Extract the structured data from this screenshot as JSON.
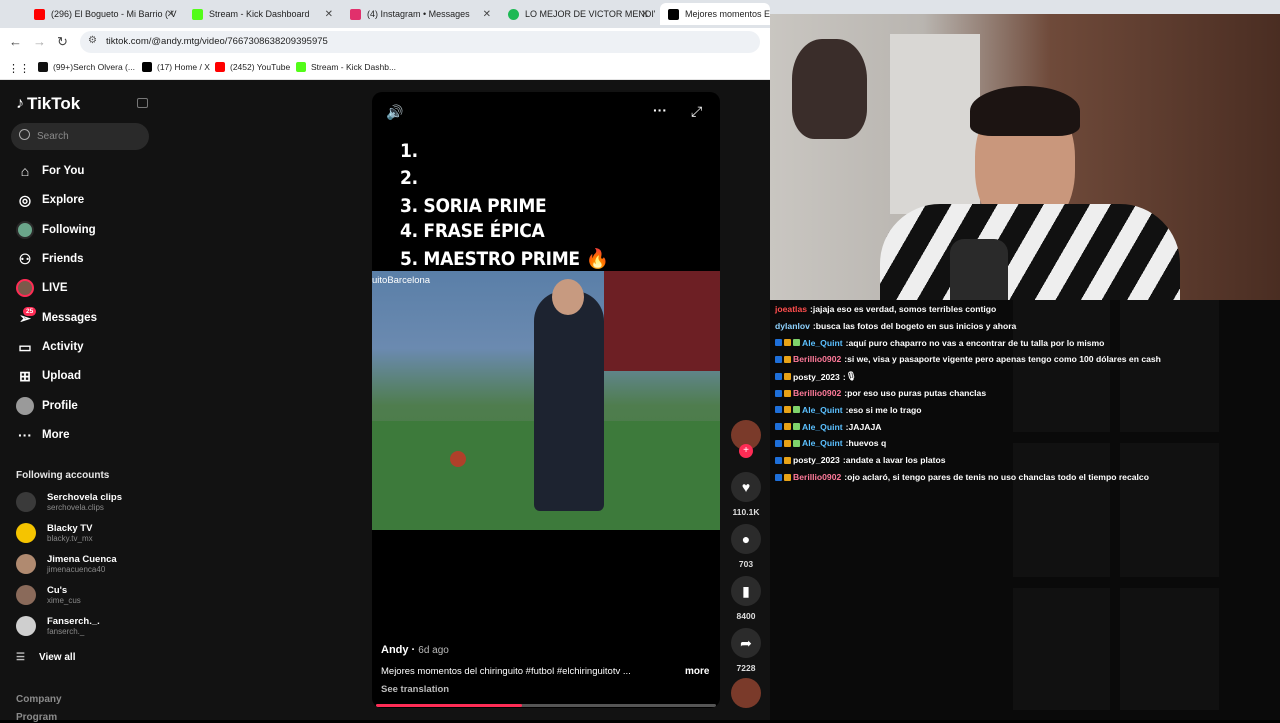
{
  "browser": {
    "tabs": [
      {
        "label": "(296) El Bogueto - Mi Barrio ( V",
        "fav": "#ff0000"
      },
      {
        "label": "Stream - Kick Dashboard",
        "fav": "#53fc18"
      },
      {
        "label": "(4) Instagram • Messages",
        "fav": "#e1306c"
      },
      {
        "label": "LO MEJOR DE VICTOR MENDIV",
        "fav": "#1db954"
      },
      {
        "label": "Mejores momentos El Ch",
        "fav": "#000000"
      }
    ],
    "url": "tiktok.com/@andy.mtg/video/7667308638209395975",
    "bookmarks": [
      {
        "label": "(99+)Serch Olvera (...",
        "fav": "#111111"
      },
      {
        "label": "(17) Home / X",
        "fav": "#000000"
      },
      {
        "label": "(2452) YouTube",
        "fav": "#ff0000"
      },
      {
        "label": "Stream - Kick Dashb...",
        "fav": "#53fc18"
      }
    ]
  },
  "tiktok": {
    "logo": "TikTok",
    "search_placeholder": "Search",
    "nav": [
      {
        "label": "For You",
        "icon": "home-icon"
      },
      {
        "label": "Explore",
        "icon": "compass-icon"
      },
      {
        "label": "Following",
        "icon": "following-avatar"
      },
      {
        "label": "Friends",
        "icon": "friends-icon"
      },
      {
        "label": "LIVE",
        "icon": "live-icon"
      },
      {
        "label": "Messages",
        "icon": "messages-icon"
      },
      {
        "label": "Activity",
        "icon": "activity-icon"
      },
      {
        "label": "Upload",
        "icon": "upload-icon"
      },
      {
        "label": "Profile",
        "icon": "profile-avatar"
      },
      {
        "label": "More",
        "icon": "more-icon"
      }
    ],
    "messages_badge": "25",
    "following_title": "Following accounts",
    "accounts": [
      {
        "name": "Serchovela clips",
        "handle": "serchovela.clips",
        "color": "#3a3a3a"
      },
      {
        "name": "Blacky TV",
        "handle": "blacky.tv_mx",
        "color": "#f5c400"
      },
      {
        "name": "Jimena Cuenca",
        "handle": "jimenacuenca40",
        "color": "#b08a70"
      },
      {
        "name": "Cu's",
        "handle": "xime_cus",
        "color": "#8a6a5a"
      },
      {
        "name": "Fanserch._.",
        "handle": "fanserch._",
        "color": "#cfcfcf"
      }
    ],
    "view_all": "View all",
    "footer": [
      "Company",
      "Program"
    ],
    "video": {
      "list": [
        "1.",
        "2.",
        "3. SORIA PRIME",
        "4. FRASE ÉPICA",
        "5. MAESTRO PRIME 🔥"
      ],
      "clip_tag": "uitoBarcelona",
      "author": "Andy",
      "ago": "6d ago",
      "caption": "Mejores momentos del chiringuito #futbol #elchiringuitotv ...",
      "more": "more",
      "see_translation": "See translation",
      "progress": 0.43
    },
    "actions": [
      {
        "icon": "heart-icon",
        "count": "110.1K"
      },
      {
        "icon": "comment-icon",
        "count": "703"
      },
      {
        "icon": "bookmark-icon",
        "count": "8400"
      },
      {
        "icon": "share-icon",
        "count": "7228"
      }
    ]
  },
  "stream": {
    "chat": [
      {
        "user": "joeatlas",
        "color": "#ff4d4d",
        "text": "jajaja eso es verdad, somos terribles contigo",
        "badges": 0
      },
      {
        "user": "dylanlov",
        "color": "#8fd3ff",
        "text": "busca las fotos del bogeto en sus inicios y ahora",
        "badges": 0
      },
      {
        "user": "Ale_Quint",
        "color": "#5bc0ff",
        "text": "aquí puro chaparro no vas a encontrar de tu talla por lo mismo",
        "badges": 3
      },
      {
        "user": "Berillio0902",
        "color": "#ff7a9a",
        "text": "si we, visa y pasaporte vigente pero apenas tengo como 100 dólares en cash",
        "badges": 2
      },
      {
        "user": "posty_2023",
        "color": "#ffffff",
        "text": "🎙",
        "badges": 2
      },
      {
        "user": "Berillio0902",
        "color": "#ff7a9a",
        "text": "por eso uso puras putas chanclas",
        "badges": 2
      },
      {
        "user": "Ale_Quint",
        "color": "#5bc0ff",
        "text": "eso si me lo trago",
        "badges": 3
      },
      {
        "user": "Ale_Quint",
        "color": "#5bc0ff",
        "text": "JAJAJA",
        "badges": 3
      },
      {
        "user": "Ale_Quint",
        "color": "#5bc0ff",
        "text": "huevos q",
        "badges": 3
      },
      {
        "user": "posty_2023",
        "color": "#ffffff",
        "text": "andate a lavar los platos",
        "badges": 2
      },
      {
        "user": "Berillio0902",
        "color": "#ff7a9a",
        "text": "ojo aclaró, si tengo pares de tenis no uso chanclas todo el tiempo recalco",
        "badges": 2
      }
    ]
  }
}
